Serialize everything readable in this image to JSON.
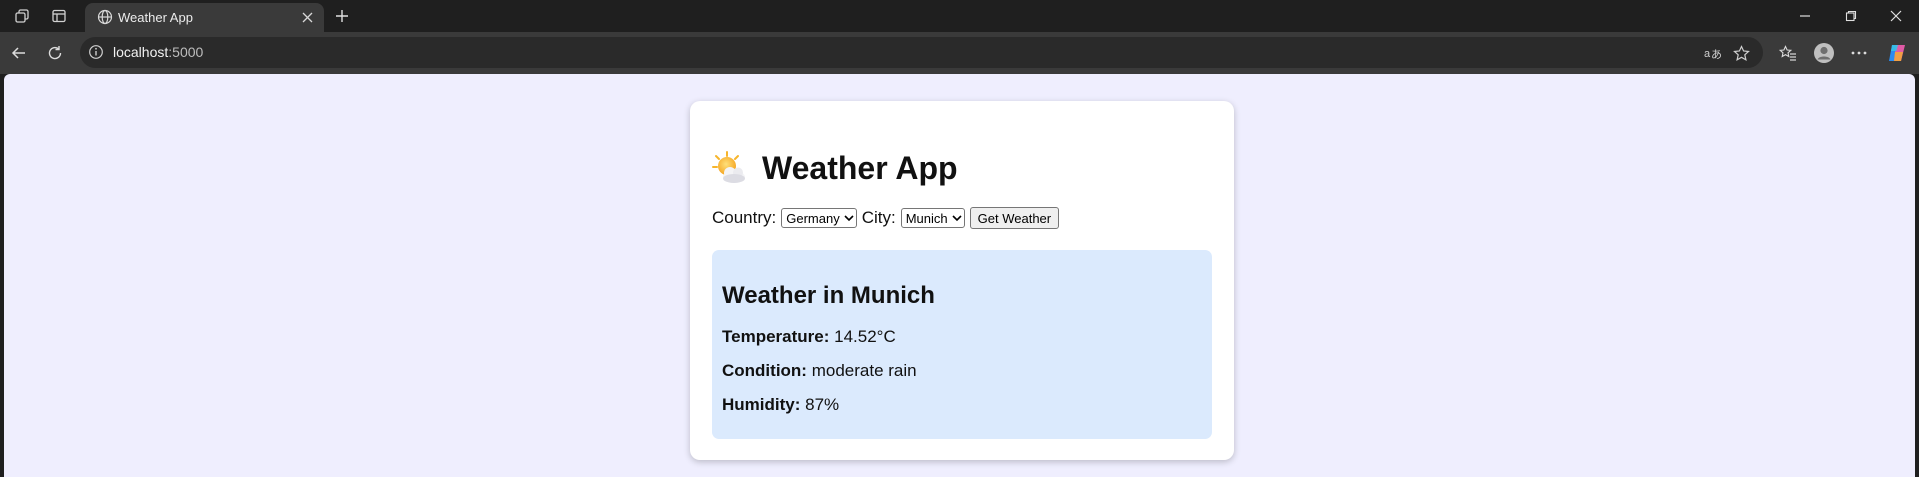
{
  "browser": {
    "tab": {
      "title": "Weather App"
    },
    "address": {
      "host": "localhost",
      "port": ":5000"
    }
  },
  "app": {
    "title": "Weather App",
    "icon": "sun-behind-cloud-icon",
    "form": {
      "country_label": "Country:",
      "country_selected": "Germany",
      "city_label": "City:",
      "city_selected": "Munich",
      "submit_label": "Get Weather"
    },
    "result": {
      "title": "Weather in Munich",
      "temperature_label": "Temperature:",
      "temperature_value": "14.52°C",
      "condition_label": "Condition:",
      "condition_value": "moderate rain",
      "humidity_label": "Humidity:",
      "humidity_value": "87%"
    }
  },
  "colors": {
    "page_background": "#efeefe",
    "card_background": "#ffffff",
    "result_background": "#dbeafd",
    "browser_chrome": "#1f1f1f"
  }
}
